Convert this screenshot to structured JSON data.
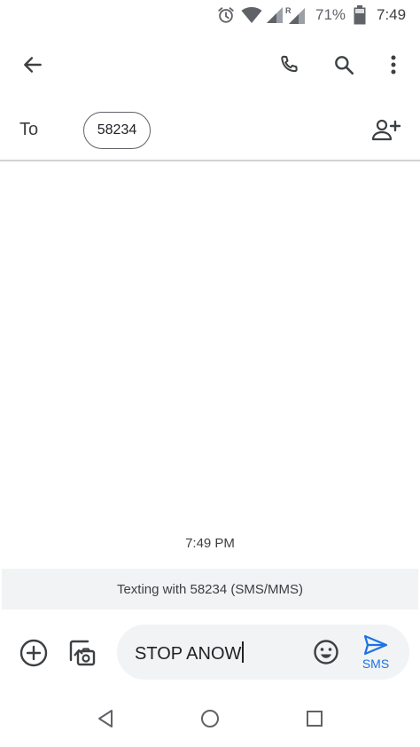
{
  "status_bar": {
    "battery_percent": "71%",
    "time": "7:49",
    "icons": [
      "alarm-icon",
      "wifi-icon",
      "signal-icon",
      "roaming-signal-icon",
      "battery-icon"
    ]
  },
  "app_bar": {
    "icons": [
      "back-arrow-icon",
      "phone-icon",
      "search-icon",
      "more-vert-icon"
    ]
  },
  "recipient": {
    "to_label": "To",
    "chip_label": "58234"
  },
  "conversation": {
    "timestamp": "7:49 PM",
    "info_banner": "Texting with 58234 (SMS/MMS)"
  },
  "compose": {
    "value": "STOP ANOW",
    "send_label": "SMS"
  },
  "colors": {
    "accent": "#1a73e8",
    "icon": "#3c4043",
    "banner_bg": "#f1f3f4"
  }
}
